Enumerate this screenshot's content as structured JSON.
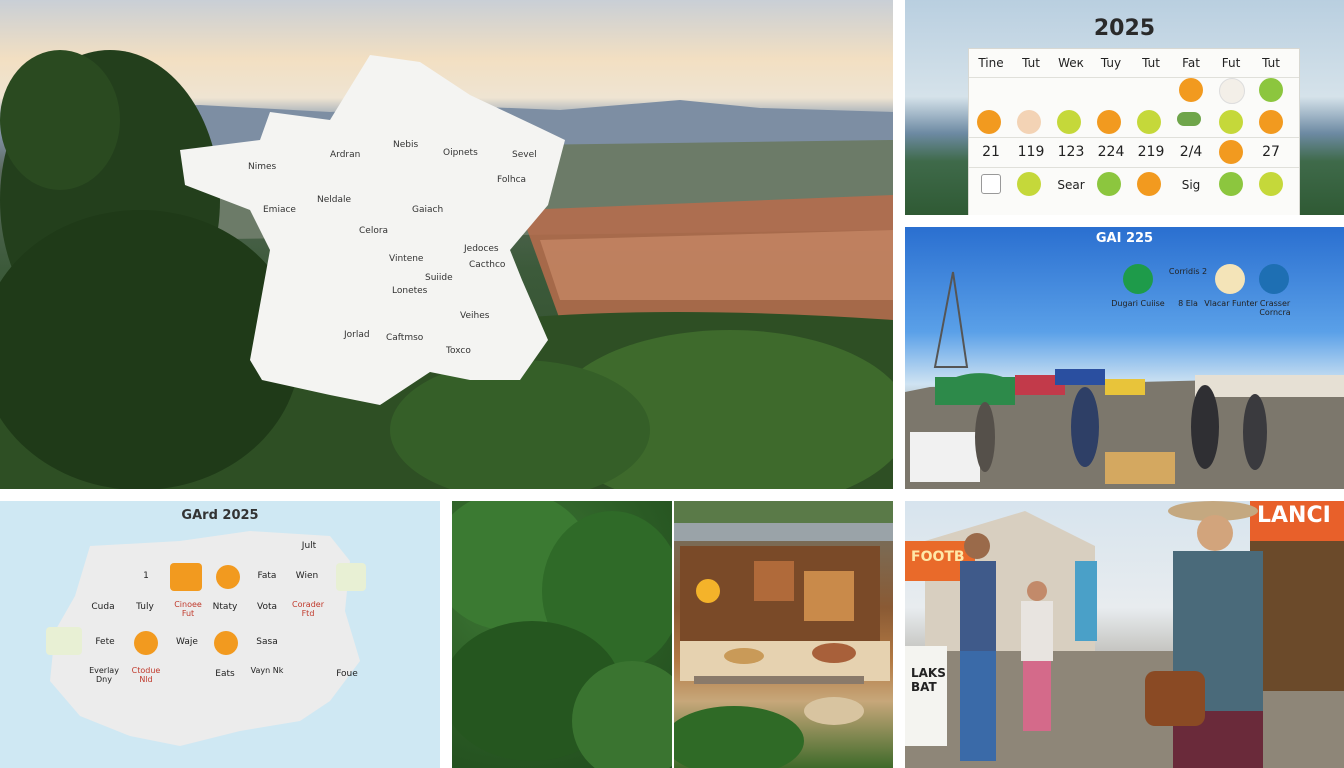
{
  "panel1": {
    "map_labels": [
      "Nimes",
      "Ardran",
      "Nebis",
      "Oipnets",
      "Sevel",
      "Folhca",
      "Emiace",
      "Neldale",
      "Gaiach",
      "Celora",
      "Vintene",
      "Suiide",
      "Jedoces",
      "Cacthco",
      "Lonetes",
      "Veihes",
      "Jorlad",
      "Caftmso",
      "Toxco"
    ]
  },
  "panel2": {
    "title": "2025",
    "headers": [
      "Tine",
      "Tut",
      "Weк",
      "Tuy",
      "Tut",
      "Fat",
      "Fut",
      "Tut"
    ],
    "row3": [
      "21",
      "119",
      "123",
      "224",
      "219",
      "2/4",
      "",
      "27"
    ],
    "row4": [
      "",
      "",
      "Sear",
      "",
      "",
      "Sig",
      "",
      ""
    ]
  },
  "panel3": {
    "title": "GAI 225",
    "legend": [
      {
        "top": "",
        "label": "Dugari Cuiise"
      },
      {
        "top": "Corridis 2",
        "label": "8 Ela"
      },
      {
        "top": "",
        "label": "Vlacar Funter"
      },
      {
        "top": "",
        "label": "Crasser Corncra"
      }
    ]
  },
  "panel4": {
    "title": "GArd 2025",
    "labels": [
      "Jult",
      "1",
      "Fata",
      "Wien",
      "Cuda",
      "Tuly",
      "Cinoee Fut",
      "Ntaty",
      "Vota",
      "Corader Ftd",
      "Fete",
      "Waje",
      "Sasa",
      "Everlay Dny",
      "Ctodue Nld",
      "Eats",
      "Vayn Nk",
      "Foue"
    ]
  },
  "panel7": {
    "banner": "LANCI",
    "sign1": "FOOTB",
    "sign2": "LAKS BAT"
  },
  "colors": {
    "orange": "#f29a1f",
    "green": "#8cc63e",
    "cream_map": "#f4f4f2"
  }
}
